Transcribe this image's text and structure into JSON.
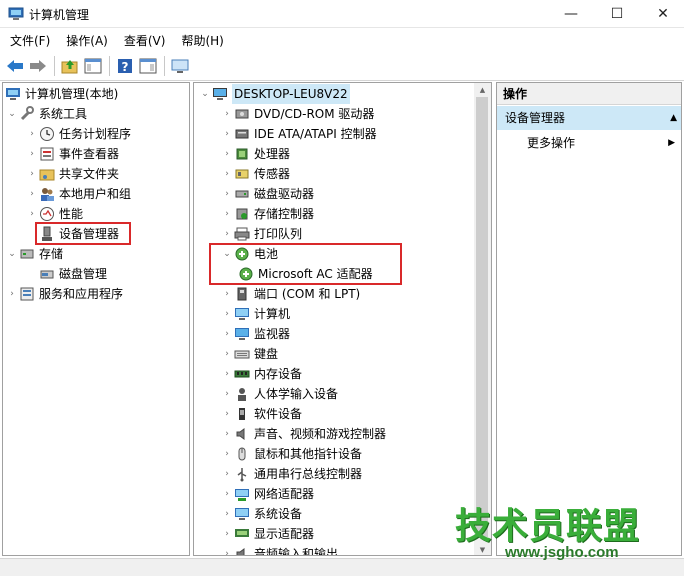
{
  "window": {
    "title": "计算机管理",
    "min_glyph": "—",
    "max_glyph": "☐",
    "close_glyph": "✕"
  },
  "menu": {
    "file": "文件(F)",
    "action": "操作(A)",
    "view": "查看(V)",
    "help": "帮助(H)"
  },
  "left_tree": {
    "root": "计算机管理(本地)",
    "system_tools": "系统工具",
    "task_scheduler": "任务计划程序",
    "event_viewer": "事件查看器",
    "shared_folders": "共享文件夹",
    "local_users": "本地用户和组",
    "performance": "性能",
    "device_manager": "设备管理器",
    "storage": "存储",
    "disk_management": "磁盘管理",
    "services_apps": "服务和应用程序"
  },
  "device_tree": {
    "root": "DESKTOP-LEU8V22",
    "items": [
      {
        "label": "DVD/CD-ROM 驱动器",
        "icon": "dvd-drive-icon"
      },
      {
        "label": "IDE ATA/ATAPI 控制器",
        "icon": "ide-controller-icon"
      },
      {
        "label": "处理器",
        "icon": "processor-icon"
      },
      {
        "label": "传感器",
        "icon": "sensor-icon"
      },
      {
        "label": "磁盘驱动器",
        "icon": "disk-drive-icon"
      },
      {
        "label": "存储控制器",
        "icon": "storage-controller-icon"
      },
      {
        "label": "打印队列",
        "icon": "printer-icon"
      },
      {
        "label": "电池",
        "icon": "battery-icon",
        "expanded": true
      },
      {
        "label": "Microsoft AC 适配器",
        "icon": "ac-adapter-icon",
        "child": true
      },
      {
        "label": "端口 (COM 和 LPT)",
        "icon": "port-icon"
      },
      {
        "label": "计算机",
        "icon": "computer-icon"
      },
      {
        "label": "监视器",
        "icon": "monitor-icon"
      },
      {
        "label": "键盘",
        "icon": "keyboard-icon"
      },
      {
        "label": "内存设备",
        "icon": "memory-icon"
      },
      {
        "label": "人体学输入设备",
        "icon": "hid-icon"
      },
      {
        "label": "软件设备",
        "icon": "software-device-icon"
      },
      {
        "label": "声音、视频和游戏控制器",
        "icon": "sound-icon"
      },
      {
        "label": "鼠标和其他指针设备",
        "icon": "mouse-icon"
      },
      {
        "label": "通用串行总线控制器",
        "icon": "usb-icon"
      },
      {
        "label": "网络适配器",
        "icon": "network-adapter-icon"
      },
      {
        "label": "系统设备",
        "icon": "system-device-icon"
      },
      {
        "label": "显示适配器",
        "icon": "display-adapter-icon"
      },
      {
        "label": "音频输入和输出",
        "icon": "audio-io-icon"
      }
    ]
  },
  "actions": {
    "header": "操作",
    "selected": "设备管理器",
    "more": "更多操作"
  },
  "watermark": {
    "cn": "技术员联盟",
    "url": "www.jsgho.com"
  },
  "colors": {
    "highlight_box": "#d9292a",
    "selection": "#cde8f7",
    "watermark": "#3aae3a"
  }
}
